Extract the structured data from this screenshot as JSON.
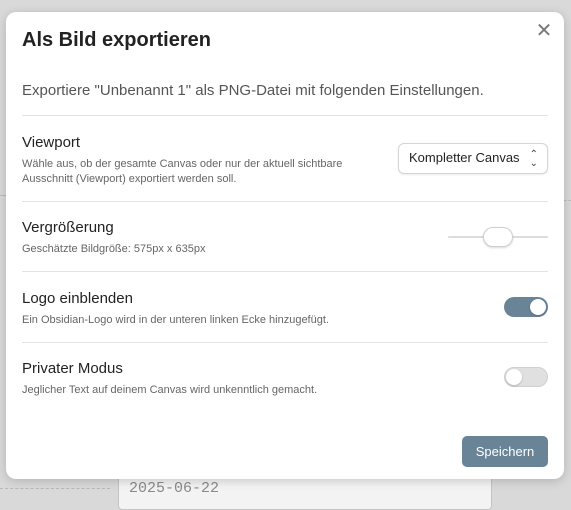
{
  "background": {
    "date_field": "2025-06-22"
  },
  "modal": {
    "title": "Als Bild exportieren",
    "close_icon": "close-icon",
    "description": "Exportiere \"Unbenannt 1\" als PNG-Datei mit folgenden Einstellungen."
  },
  "settings": [
    {
      "name": "Viewport",
      "description": "Wähle aus, ob der gesamte Canvas oder nur der aktuell sichtbare Ausschnitt (Viewport) exportiert werden soll.",
      "control": "dropdown",
      "selected": "Kompletter Canvas"
    },
    {
      "name": "Vergrößerung",
      "description": "Geschätzte Bildgröße: 575px x 635px",
      "control": "slider",
      "value_fraction": 0.5
    },
    {
      "name": "Logo einblenden",
      "description": "Ein Obsidian-Logo wird in der unteren linken Ecke hinzugefügt.",
      "control": "toggle",
      "enabled": true
    },
    {
      "name": "Privater Modus",
      "description": "Jeglicher Text auf deinem Canvas wird unkenntlich gemacht.",
      "control": "toggle",
      "enabled": false
    }
  ],
  "save_label": "Speichern",
  "colors": {
    "accent": "#6a8497",
    "toggle_on": "#6a8497",
    "toggle_off": "#e0e0e0"
  }
}
